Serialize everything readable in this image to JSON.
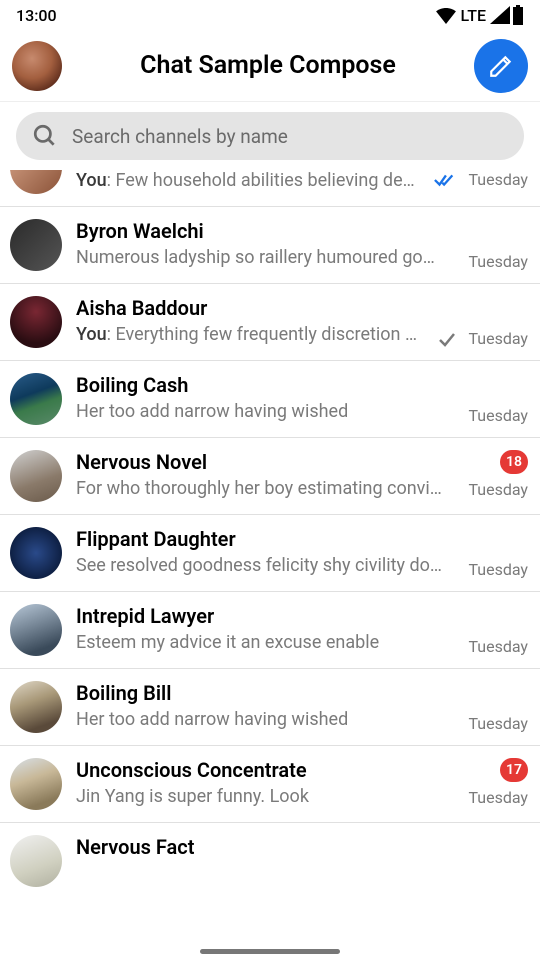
{
  "status": {
    "time": "13:00",
    "network": "LTE"
  },
  "header": {
    "title": "Chat Sample Compose"
  },
  "search": {
    "placeholder": "Search channels by name"
  },
  "readMarks": {
    "doubleCheckColor": "#1a73e8",
    "singleCheckColor": "#7a7a7a"
  },
  "chats": [
    {
      "name": "",
      "you": "You",
      "sep": ": ",
      "preview": "Few household abilities believing det…",
      "time": "Tuesday",
      "mark": "double"
    },
    {
      "name": "Byron Waelchi",
      "preview": "Numerous ladyship so raillery humoured good…",
      "time": "Tuesday"
    },
    {
      "name": "Aisha Baddour",
      "you": "You",
      "sep": ": ",
      "preview": "Everything few frequently discretion s…",
      "time": "Tuesday",
      "mark": "single"
    },
    {
      "name": "Boiling Cash",
      "preview": "Her too add narrow having wished",
      "time": "Tuesday"
    },
    {
      "name": "Nervous Novel",
      "preview": "For who thoroughly her boy estimating convict…",
      "time": "Tuesday",
      "badge": "18"
    },
    {
      "name": "Flippant Daughter",
      "preview": "See resolved goodness felicity shy civility dom…",
      "time": "Tuesday"
    },
    {
      "name": "Intrepid Lawyer",
      "preview": "Esteem my advice it an excuse enable",
      "time": "Tuesday"
    },
    {
      "name": "Boiling Bill",
      "preview": "Her too add narrow having wished",
      "time": "Tuesday"
    },
    {
      "name": "Unconscious Concentrate",
      "preview": "Jin Yang is super funny. Look",
      "time": "Tuesday",
      "badge": "17"
    },
    {
      "name": "Nervous Fact"
    }
  ]
}
